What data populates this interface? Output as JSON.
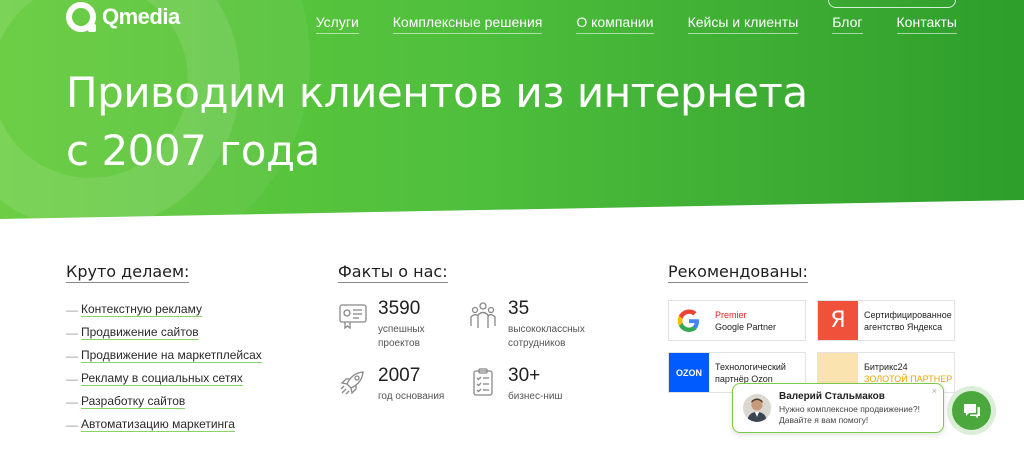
{
  "brand": {
    "logo_text": "Qmedia",
    "accent": "#4fbf3d",
    "link_underline": "#8ad36b"
  },
  "nav": {
    "items": [
      "Услуги",
      "Комплексные решения",
      "О компании",
      "Кейсы и клиенты",
      "Блог",
      "Контакты"
    ]
  },
  "hero": {
    "title_line1": "Приводим клиентов из интернета",
    "title_line2": "с 2007 года"
  },
  "services": {
    "heading": "Круто делаем:",
    "items": [
      "Контекстную рекламу",
      "Продвижение сайтов",
      "Продвижение на маркетплейсах",
      "Рекламу в социальных сетях",
      "Разработку сайтов",
      "Автоматизацию маркетинга"
    ]
  },
  "facts": {
    "heading": "Факты о нас:",
    "items": [
      {
        "icon": "certificate-icon",
        "number": "3590",
        "caption_1": "успешных",
        "caption_2": "проектов"
      },
      {
        "icon": "team-icon",
        "number": "35",
        "caption_1": "высококлассных",
        "caption_2": "сотрудников"
      },
      {
        "icon": "rocket-icon",
        "number": "2007",
        "caption_1": "год основания",
        "caption_2": ""
      },
      {
        "icon": "checklist-icon",
        "number": "30+",
        "caption_1": "бизнес-ниш",
        "caption_2": ""
      }
    ]
  },
  "recommended": {
    "heading": "Рекомендованы:",
    "cards": [
      {
        "icon": "google-icon",
        "line1": "Premier",
        "line2": "Google Partner"
      },
      {
        "icon": "yandex-icon",
        "line1": "Сертифицированное",
        "line2": "агентство Яндекса"
      },
      {
        "icon": "ozon-icon",
        "logo_text": "OZON",
        "line1": "Технологический",
        "line2": "партнёр Ozon"
      },
      {
        "icon": "bitrix24-icon",
        "line1": "Битрикс24",
        "line2": "ЗОЛОТОЙ ПАРТНЕР"
      }
    ]
  },
  "chat": {
    "name": "Валерий Стальмаков",
    "message_1": "Нужно комплексное продвижение?!",
    "message_2": "Давайте я вам помогу!",
    "close": "×"
  }
}
